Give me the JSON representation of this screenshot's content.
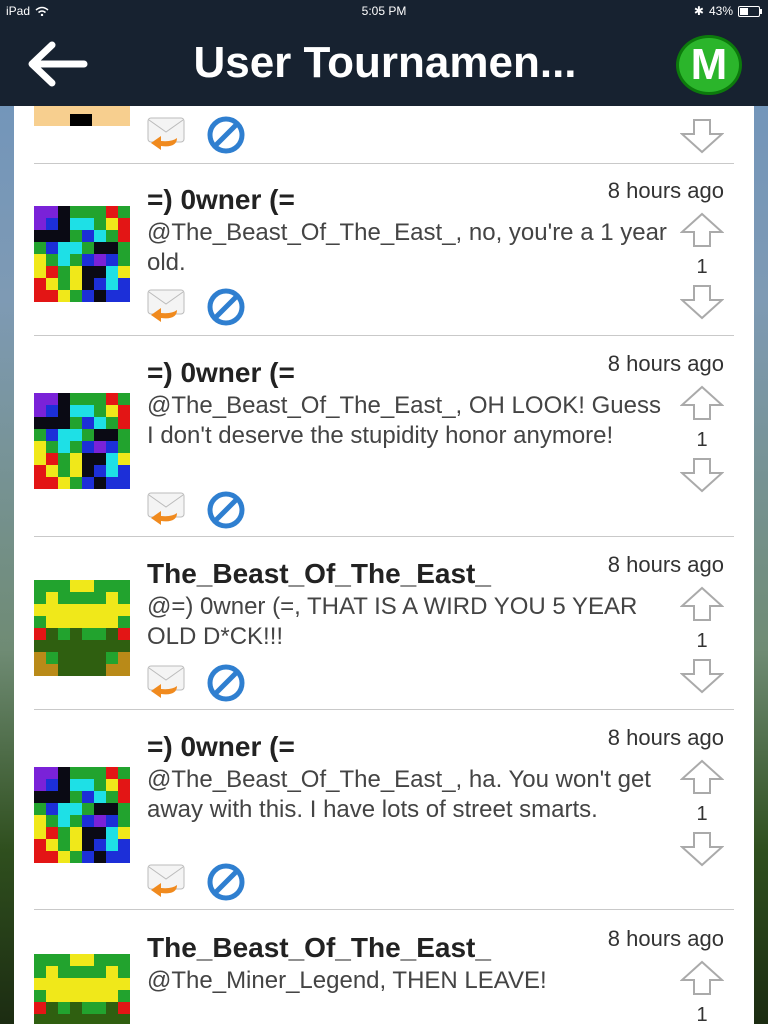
{
  "status": {
    "device": "iPad",
    "time": "5:05 PM",
    "battery": "43%",
    "battery_level": 0.43
  },
  "nav": {
    "title": "User Tournamen...",
    "badge": "M"
  },
  "comments": [
    {
      "user": "=) 0wner (=",
      "time": "8 hours ago",
      "text": "@The_Beast_Of_The_East_, no, you're a 1 year old.",
      "score": "1"
    },
    {
      "user": "=) 0wner (=",
      "time": "8 hours ago",
      "text": "@The_Beast_Of_The_East_, OH LOOK! Guess I don't deserve the stupidity honor anymore!",
      "score": "1"
    },
    {
      "user": "The_Beast_Of_The_East_",
      "time": "8 hours ago",
      "text": "@=) 0wner (=, THAT IS A WIRD YOU 5 YEAR OLD D*CK!!!",
      "score": "1"
    },
    {
      "user": "=) 0wner (=",
      "time": "8 hours ago",
      "text": "@The_Beast_Of_The_East_, ha. You won't get away with this. I have lots of street smarts.",
      "score": "1"
    },
    {
      "user": "The_Beast_Of_The_East_",
      "time": "8 hours ago",
      "text": "@The_Miner_Legend, THEN LEAVE!",
      "score": "1"
    }
  ],
  "colors": {
    "navbar": "#172230",
    "badge": "#2bb52b",
    "reply_orange": "#f08a1e",
    "block_blue": "#2f7fd0"
  }
}
